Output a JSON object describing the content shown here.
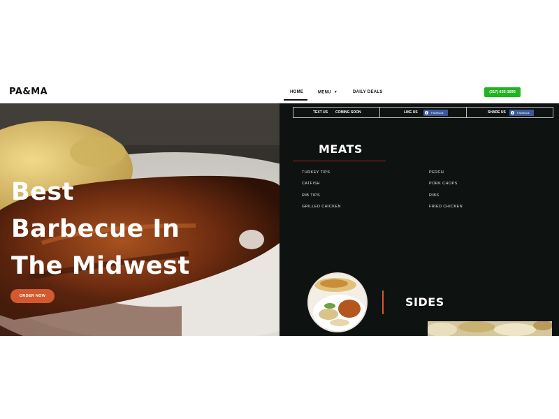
{
  "header": {
    "logo": "PA&MA",
    "nav": [
      {
        "label": "HOME",
        "active": true
      },
      {
        "label": "MENU",
        "has_dropdown": true
      },
      {
        "label": "DAILY DEALS"
      }
    ],
    "phone": "(317) 635-1695"
  },
  "hero": {
    "title_lines": [
      "Best",
      "Barbecue In",
      "The Midwest"
    ],
    "order_button": "ORDER NOW"
  },
  "social": {
    "text_us_label": "TEXT US",
    "text_us_value": "COMING SOON",
    "like_us_label": "LIKE US",
    "share_us_label": "SHARE US",
    "facebook_label": "Facebook"
  },
  "meats": {
    "title": "MEATS",
    "column_1": [
      "TURKEY TIPS",
      "CATFISH",
      "RIB TIPS",
      "GRILLED CHICKEN"
    ],
    "column_2": [
      "PERCH",
      "PORK CHOPS",
      "RIBS",
      "FRIED CHICKEN"
    ]
  },
  "sides": {
    "title": "SIDES"
  },
  "colors": {
    "accent_orange": "#d35a2e",
    "phone_green": "#1fb51f",
    "panel_bg": "#0e1210",
    "meats_rule_red": "#b52020",
    "facebook_blue": "#3b5998"
  }
}
